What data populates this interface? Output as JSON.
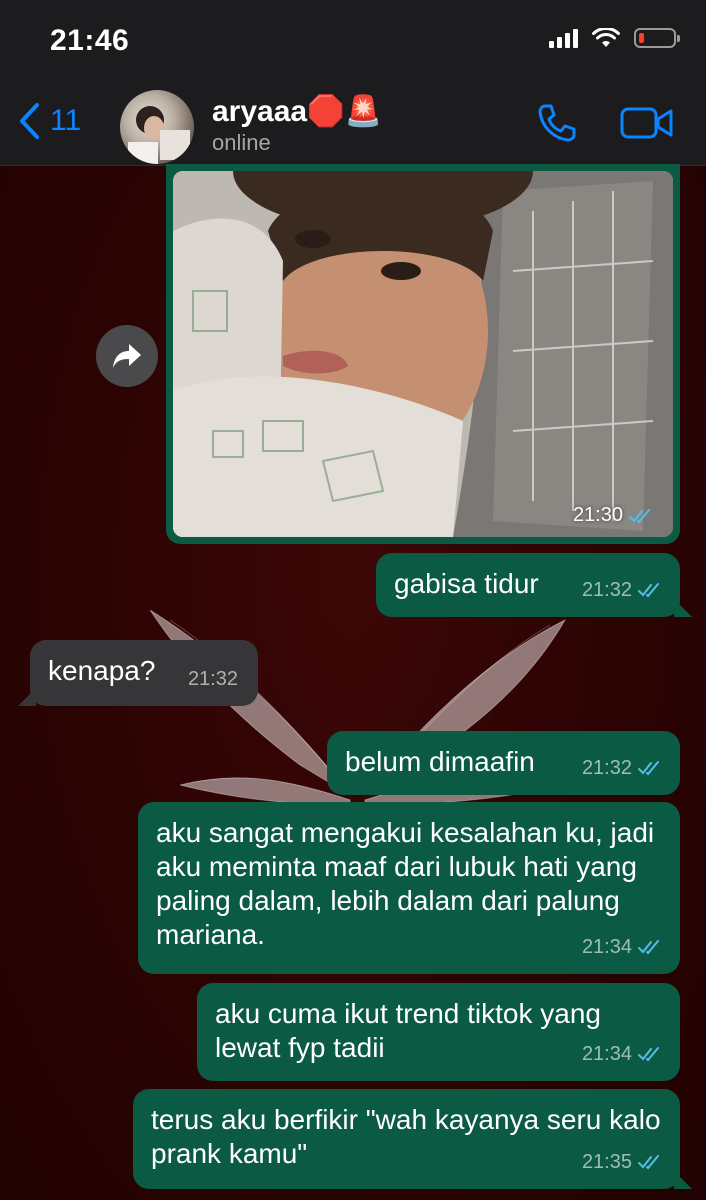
{
  "status_bar": {
    "time": "21:46",
    "battery_level": 0.15
  },
  "header": {
    "back_count": "11",
    "contact_name": "aryaaa🛑🚨",
    "contact_status": "online"
  },
  "image_message": {
    "time": "21:30"
  },
  "messages": [
    {
      "text": "gabisa tidur",
      "time": "21:32",
      "direction": "out"
    },
    {
      "text": "kenapa?",
      "time": "21:32",
      "direction": "in"
    },
    {
      "text": "belum dimaafin",
      "time": "21:32",
      "direction": "out"
    },
    {
      "text": "aku sangat mengakui kesalahan ku, jadi aku meminta maaf dari lubuk hati yang paling dalam, lebih dalam dari palung mariana.",
      "time": "21:34",
      "direction": "out"
    },
    {
      "text": "aku cuma ikut trend tiktok yang lewat fyp tadii",
      "time": "21:34",
      "direction": "out"
    },
    {
      "text": "terus aku berfikir \"wah kayanya seru kalo prank kamu\"",
      "time": "21:35",
      "direction": "out"
    }
  ],
  "colors": {
    "outgoing_bubble": "#0b5a44",
    "incoming_bubble": "#363638",
    "accent": "#0a84ff",
    "read_ticks": "#53bdeb",
    "wallpaper": "#2a0404"
  }
}
